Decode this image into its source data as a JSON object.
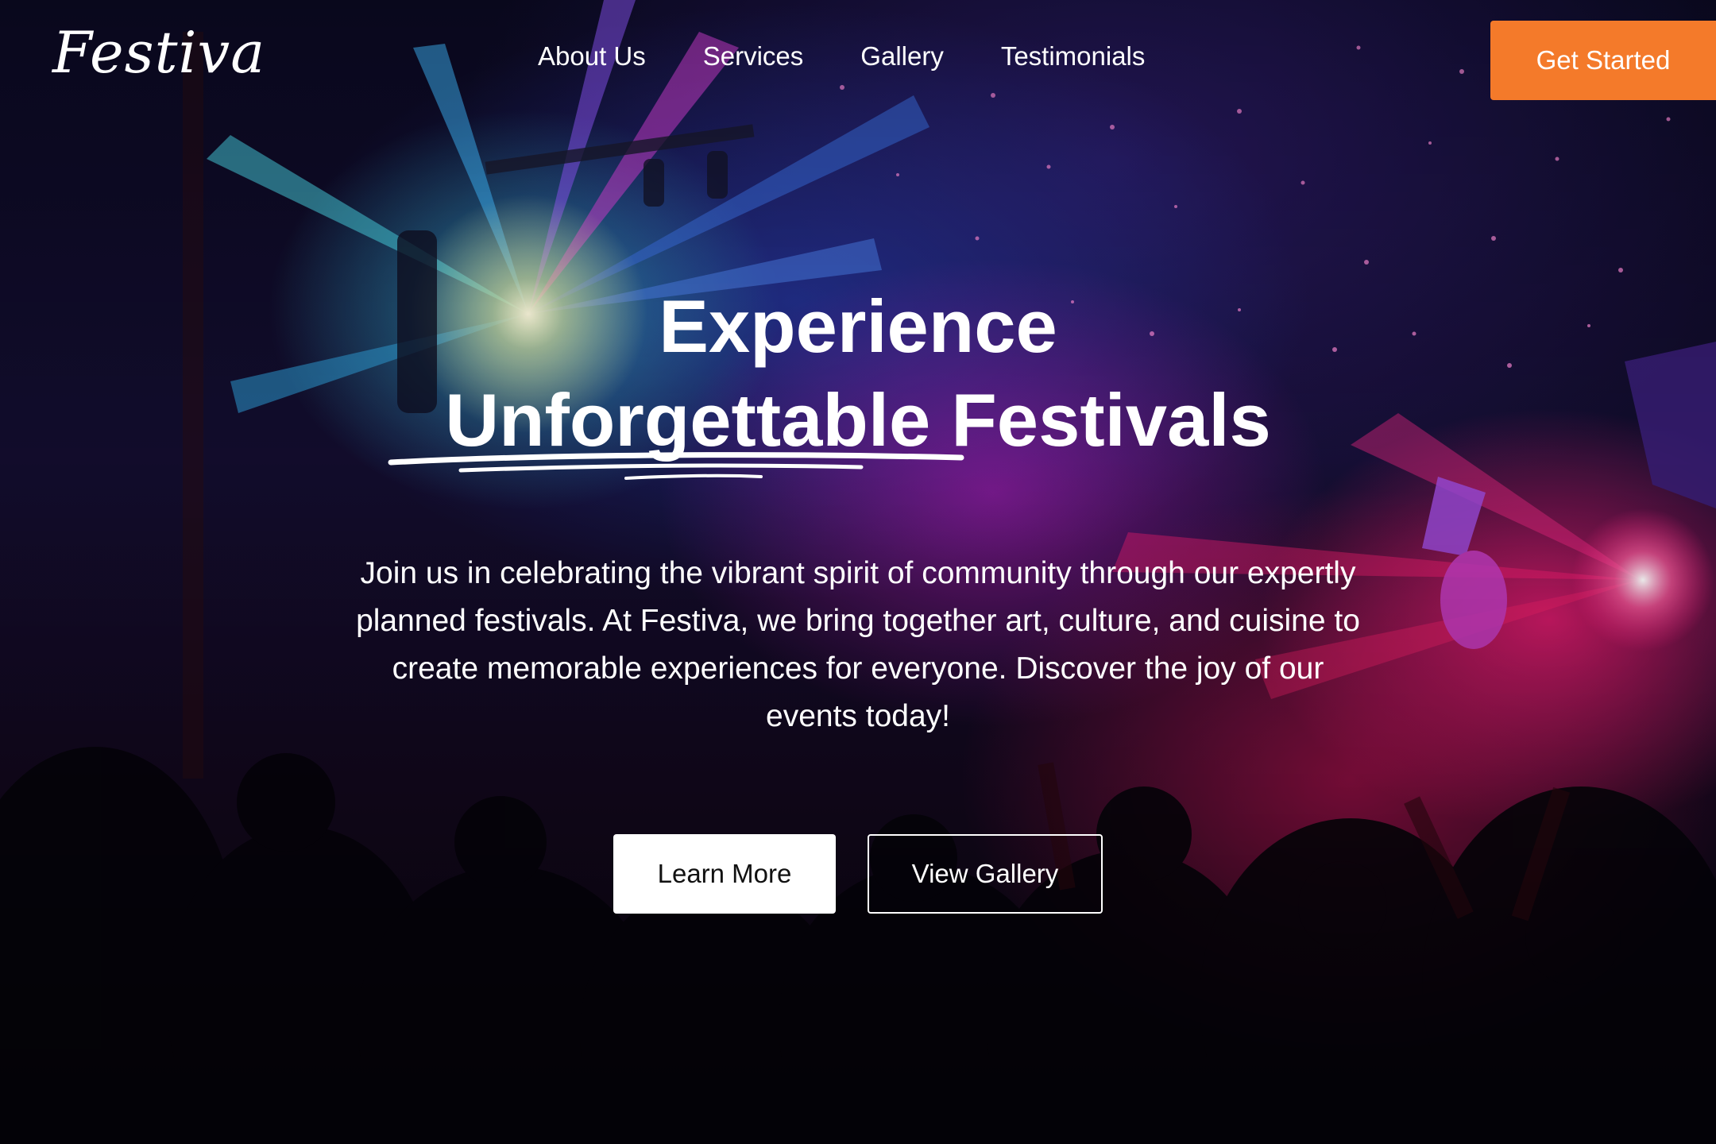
{
  "brand": {
    "logo": "Festiva"
  },
  "nav": {
    "items": [
      {
        "label": "About Us"
      },
      {
        "label": "Services"
      },
      {
        "label": "Gallery"
      },
      {
        "label": "Testimonials"
      }
    ],
    "cta_label": "Get Started"
  },
  "hero": {
    "headline_line1": "Experience",
    "headline_accent": "Unforgettable",
    "headline_rest": "Festivals",
    "description": "Join us in celebrating the vibrant spirit of community through our expertly planned festivals. At Festiva, we bring together art, culture, and cuisine to create memorable experiences for everyone. Discover the joy of our events today!",
    "primary_button": "Learn More",
    "secondary_button": "View Gallery"
  },
  "colors": {
    "accent": "#f47a2a",
    "text": "#ffffff",
    "primary_button_bg": "#ffffff"
  },
  "icons": {
    "headline_underline": "brush-underline-icon"
  }
}
